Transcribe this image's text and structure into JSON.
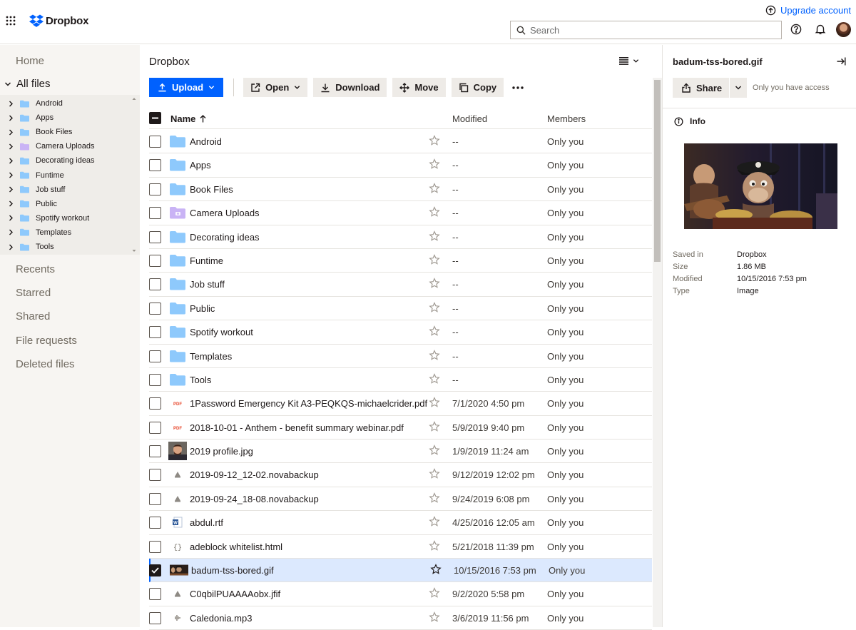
{
  "header": {
    "brand": "Dropbox",
    "upgrade": "Upgrade account",
    "search_placeholder": "Search"
  },
  "nav": {
    "home": "Home",
    "all_files": "All files",
    "tree": [
      "Android",
      "Apps",
      "Book Files",
      "Camera Uploads",
      "Decorating ideas",
      "Funtime",
      "Job stuff",
      "Public",
      "Spotify workout",
      "Templates",
      "Tools"
    ],
    "links": [
      "Recents",
      "Starred",
      "Shared",
      "File requests",
      "Deleted files"
    ]
  },
  "main": {
    "breadcrumb": "Dropbox",
    "toolbar": {
      "upload": "Upload",
      "open": "Open",
      "download": "Download",
      "move": "Move",
      "copy": "Copy"
    },
    "columns": {
      "name": "Name",
      "modified": "Modified",
      "members": "Members"
    },
    "rows": [
      {
        "name": "Android",
        "type": "folder",
        "modified": "--",
        "members": "Only you"
      },
      {
        "name": "Apps",
        "type": "folder",
        "modified": "--",
        "members": "Only you"
      },
      {
        "name": "Book Files",
        "type": "folder",
        "modified": "--",
        "members": "Only you"
      },
      {
        "name": "Camera Uploads",
        "type": "camera-folder",
        "modified": "--",
        "members": "Only you"
      },
      {
        "name": "Decorating ideas",
        "type": "folder",
        "modified": "--",
        "members": "Only you"
      },
      {
        "name": "Funtime",
        "type": "folder",
        "modified": "--",
        "members": "Only you"
      },
      {
        "name": "Job stuff",
        "type": "folder",
        "modified": "--",
        "members": "Only you"
      },
      {
        "name": "Public",
        "type": "folder",
        "modified": "--",
        "members": "Only you"
      },
      {
        "name": "Spotify workout",
        "type": "folder",
        "modified": "--",
        "members": "Only you"
      },
      {
        "name": "Templates",
        "type": "folder",
        "modified": "--",
        "members": "Only you"
      },
      {
        "name": "Tools",
        "type": "folder",
        "modified": "--",
        "members": "Only you"
      },
      {
        "name": "1Password Emergency Kit A3-PEQKQS-michaelcrider.pdf",
        "type": "pdf",
        "modified": "7/1/2020 4:50 pm",
        "members": "Only you"
      },
      {
        "name": "2018-10-01 - Anthem - benefit summary webinar.pdf",
        "type": "pdf",
        "modified": "5/9/2019 9:40 pm",
        "members": "Only you"
      },
      {
        "name": "2019 profile.jpg",
        "type": "photo",
        "modified": "1/9/2019 11:24 am",
        "members": "Only you"
      },
      {
        "name": "2019-09-12_12-02.novabackup",
        "type": "generic",
        "modified": "9/12/2019 12:02 pm",
        "members": "Only you"
      },
      {
        "name": "2019-09-24_18-08.novabackup",
        "type": "generic",
        "modified": "9/24/2019 6:08 pm",
        "members": "Only you"
      },
      {
        "name": "abdul.rtf",
        "type": "word",
        "modified": "4/25/2016 12:05 am",
        "members": "Only you"
      },
      {
        "name": "adeblock whitelist.html",
        "type": "code",
        "modified": "5/21/2018 11:39 pm",
        "members": "Only you"
      },
      {
        "name": "badum-tss-bored.gif",
        "type": "gif",
        "modified": "10/15/2016 7:53 pm",
        "members": "Only you",
        "selected": true
      },
      {
        "name": "C0qbilPUAAAAobx.jfif",
        "type": "generic",
        "modified": "9/2/2020 5:58 pm",
        "members": "Only you"
      },
      {
        "name": "Caledonia.mp3",
        "type": "audio",
        "modified": "3/6/2019 11:56 pm",
        "members": "Only you"
      }
    ]
  },
  "panel": {
    "title": "badum-tss-bored.gif",
    "share": "Share",
    "access": "Only you have access",
    "info": "Info",
    "meta": [
      {
        "key": "Saved in",
        "value": "Dropbox"
      },
      {
        "key": "Size",
        "value": "1.86 MB"
      },
      {
        "key": "Modified",
        "value": "10/15/2016 7:53 pm"
      },
      {
        "key": "Type",
        "value": "Image"
      }
    ]
  },
  "colors": {
    "accent": "#0061fe",
    "folder": "#8ec9fc",
    "selected_row": "#dce9fe",
    "sidebar": "#f7f5f2"
  }
}
